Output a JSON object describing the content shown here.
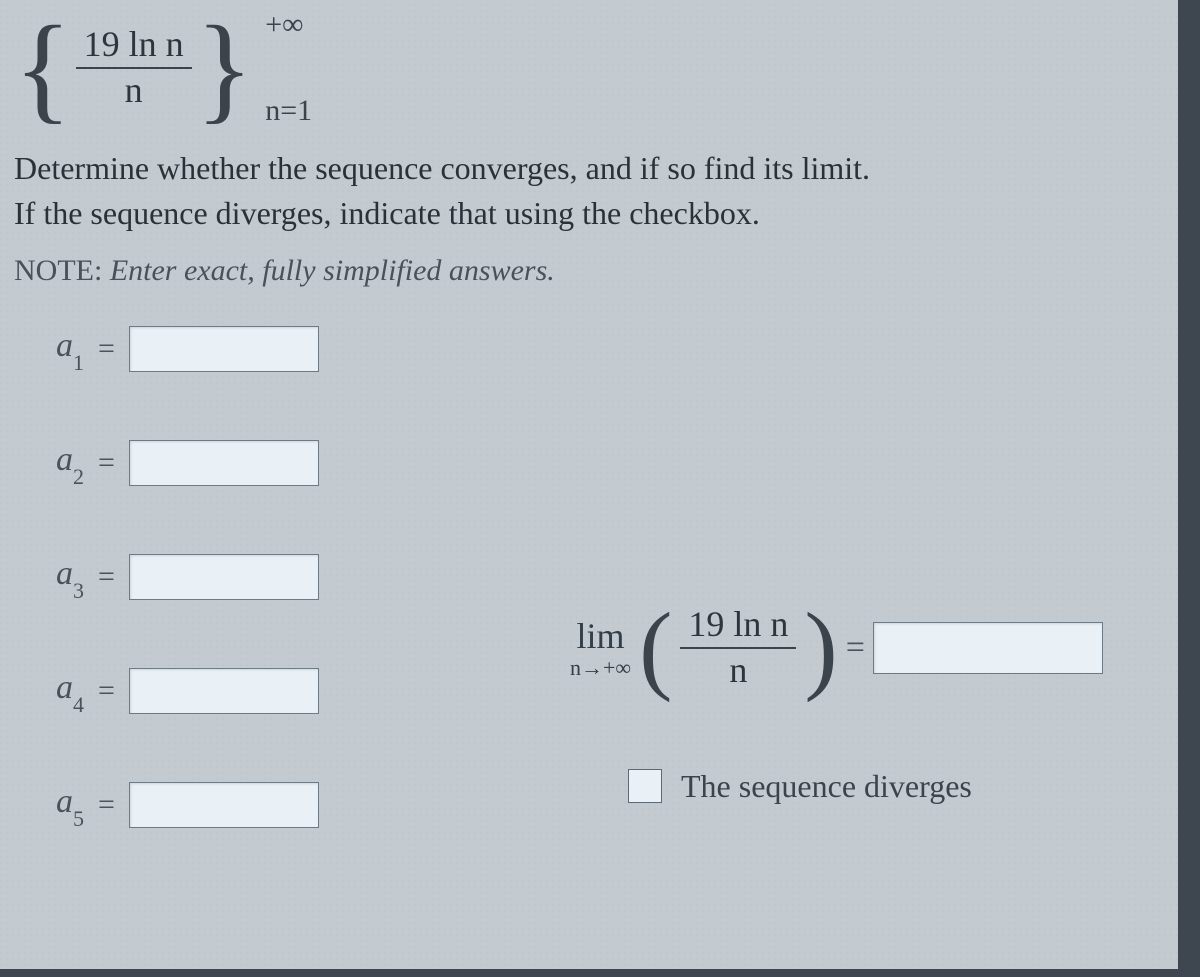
{
  "sequence": {
    "numerator": "19 ln n",
    "denominator": "n",
    "upper": "+∞",
    "lower": "n=1"
  },
  "instructions_line1": "Determine whether the sequence converges, and if so find its limit.",
  "instructions_line2": "If the sequence diverges, indicate that using the checkbox.",
  "note_prefix": "NOTE:  ",
  "note_emph": "Enter exact, fully simplified answers.",
  "terms": [
    {
      "label": "a",
      "sub": "1"
    },
    {
      "label": "a",
      "sub": "2"
    },
    {
      "label": "a",
      "sub": "3"
    },
    {
      "label": "a",
      "sub": "4"
    },
    {
      "label": "a",
      "sub": "5"
    }
  ],
  "equals": "=",
  "limit": {
    "lim": "lim",
    "approach": "n→+∞",
    "numerator": "19 ln n",
    "denominator": "n"
  },
  "diverges_label": "The sequence diverges"
}
